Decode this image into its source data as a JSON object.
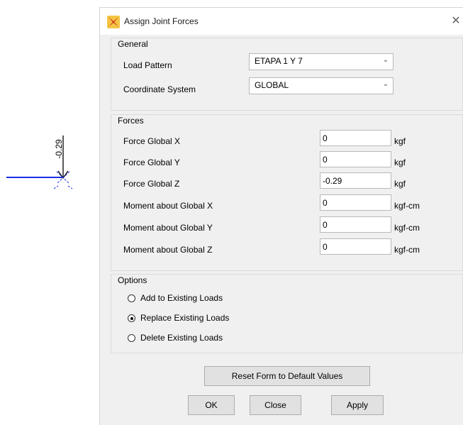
{
  "canvas": {
    "load_value": "-0.29",
    "member_color": "#1a2ee6"
  },
  "dialog": {
    "title": "Assign Joint Forces",
    "close_glyph": "✕",
    "general": {
      "title": "General",
      "load_pattern_label": "Load Pattern",
      "load_pattern_value": "ETAPA 1 Y 7",
      "coordinate_system_label": "Coordinate System",
      "coordinate_system_value": "GLOBAL"
    },
    "forces": {
      "title": "Forces",
      "rows": [
        {
          "label": "Force Global X",
          "value": "0",
          "unit": "kgf"
        },
        {
          "label": "Force Global Y",
          "value": "0",
          "unit": "kgf"
        },
        {
          "label": "Force Global Z",
          "value": "-0.29",
          "unit": "kgf"
        },
        {
          "label": "Moment about Global X",
          "value": "0",
          "unit": "kgf-cm"
        },
        {
          "label": "Moment about Global Y",
          "value": "0",
          "unit": "kgf-cm"
        },
        {
          "label": "Moment about Global Z",
          "value": "0",
          "unit": "kgf-cm"
        }
      ]
    },
    "options": {
      "title": "Options",
      "items": [
        {
          "label": "Add to Existing Loads",
          "selected": false
        },
        {
          "label": "Replace Existing Loads",
          "selected": true
        },
        {
          "label": "Delete Existing Loads",
          "selected": false
        }
      ]
    },
    "buttons": {
      "reset": "Reset Form to Default Values",
      "ok": "OK",
      "close": "Close",
      "apply": "Apply"
    }
  }
}
